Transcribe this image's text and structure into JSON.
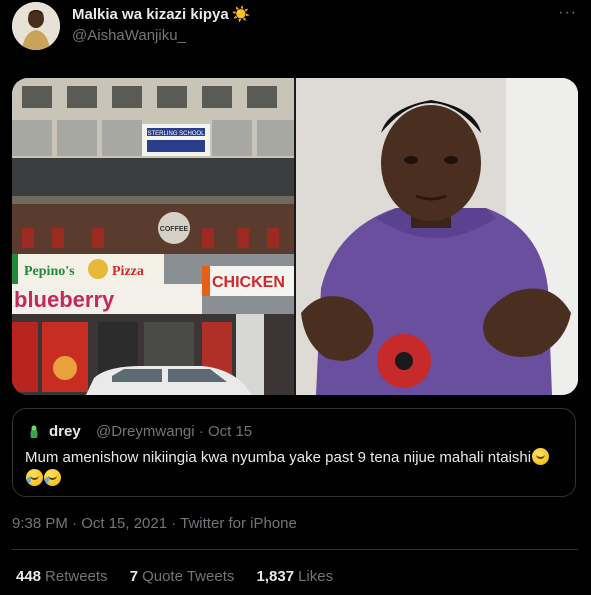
{
  "author": {
    "name": "Malkia wa kizazi kipya",
    "sun_emoji": "☀️",
    "handle": "@AishaWanjiku_"
  },
  "more_icon": "more-icon",
  "media": {
    "left_signs": {
      "banner": "STERLING SCHOOL",
      "pepinos": "Pepino's",
      "pizza": "Pizza",
      "blueberry": "blueberry",
      "chicken": "CHICKEN",
      "coffee": "COFFEE"
    }
  },
  "quoted": {
    "name": "drey",
    "handle": "@Dreymwangi",
    "date": "Oct 15",
    "text": "Mum amenishow nikiingia kwa nyumba yake  past 9 tena nijue mahali ntaishi"
  },
  "timestamp": "9:38 PM · Oct 15, 2021 · Twitter for iPhone",
  "stats": {
    "retweets_count": "448",
    "retweets_label": "Retweets",
    "quotes_count": "7",
    "quotes_label": "Quote Tweets",
    "likes_count": "1,837",
    "likes_label": "Likes"
  },
  "colors": {
    "background": "#000000",
    "text": "#e7e9ea",
    "muted": "#71767b",
    "border": "#2f3336"
  }
}
